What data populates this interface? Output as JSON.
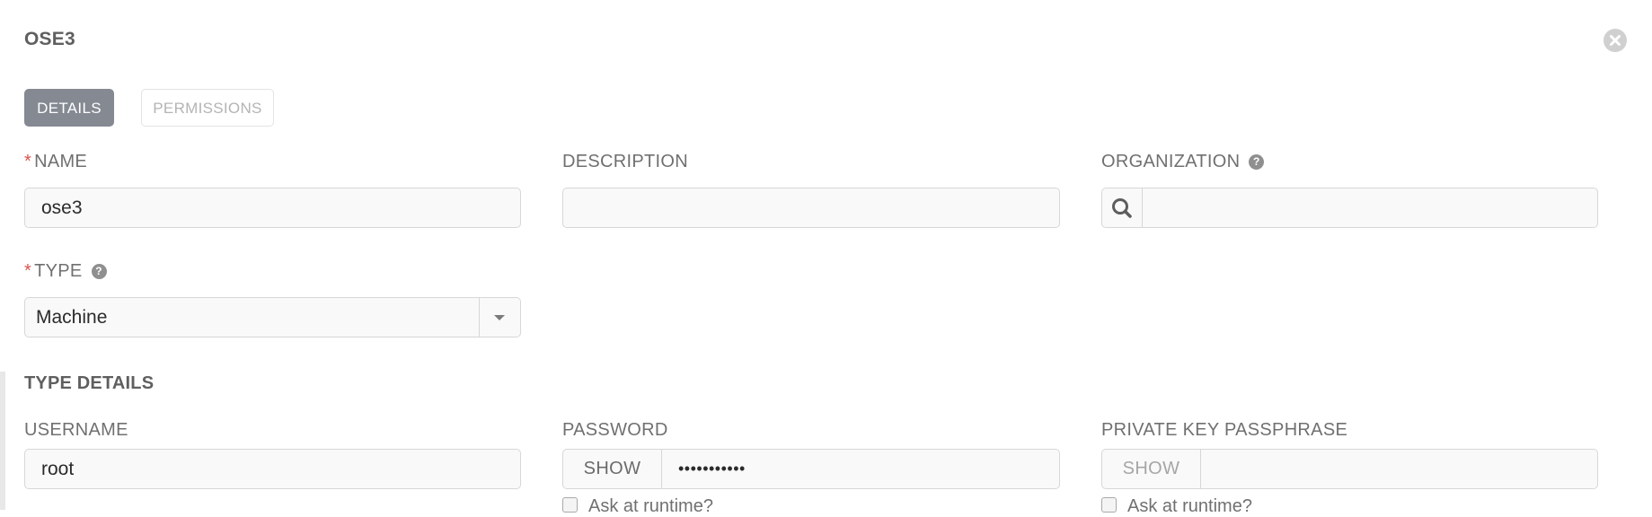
{
  "header": {
    "title": "OSE3"
  },
  "tabs": [
    {
      "label": "DETAILS",
      "active": true
    },
    {
      "label": "PERMISSIONS",
      "active": false
    }
  ],
  "fields": {
    "name": {
      "label": "NAME",
      "required": true,
      "value": "ose3"
    },
    "description": {
      "label": "DESCRIPTION",
      "value": ""
    },
    "organization": {
      "label": "ORGANIZATION",
      "value": ""
    },
    "type": {
      "label": "TYPE",
      "required": true,
      "value": "Machine"
    }
  },
  "type_details": {
    "title": "TYPE DETAILS",
    "username": {
      "label": "USERNAME",
      "value": "root"
    },
    "password": {
      "label": "PASSWORD",
      "show_label": "SHOW",
      "value": "•••••••••••",
      "ask_label": "Ask at runtime?"
    },
    "passphrase": {
      "label": "PRIVATE KEY PASSPHRASE",
      "show_label": "SHOW",
      "value": "",
      "ask_label": "Ask at runtime?"
    }
  },
  "icons": {
    "close": "close-icon",
    "help": "question-circle-icon",
    "search": "search-icon",
    "dropdown": "caret-down-icon"
  },
  "colors": {
    "active_tab": "#848992",
    "required": "#d9534f",
    "input_bg": "#f9f9f9"
  }
}
